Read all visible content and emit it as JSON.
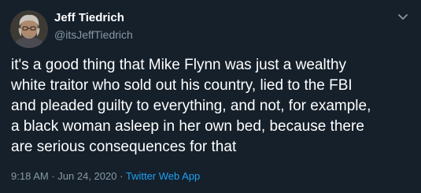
{
  "author": {
    "display_name": "Jeff Tiedrich",
    "handle": "@itsJeffTiedrich"
  },
  "tweet": {
    "text": "it's a good thing that Mike Flynn was just a wealthy\nwhite traitor who sold out his country, lied to the FBI\nand pleaded guilty to everything, and not, for example,\na black woman asleep in her own bed, because there\nare serious consequences for that",
    "time": "9:18 AM",
    "date": "Jun 24, 2020",
    "separator": "·",
    "source": "Twitter Web App"
  },
  "icons": {
    "avatar": "profile-photo",
    "menu": "chevron-down-icon"
  },
  "colors": {
    "background": "#15202b",
    "text": "#ffffff",
    "secondary": "#8899a6",
    "link": "#1da1f2"
  }
}
